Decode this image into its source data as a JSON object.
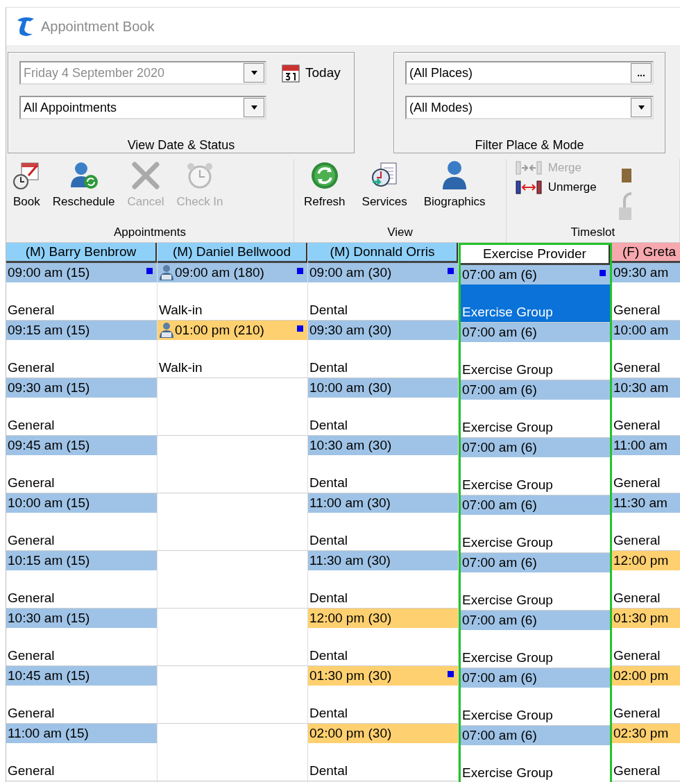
{
  "window": {
    "title": "Appointment Book"
  },
  "view_panel": {
    "caption": "View Date & Status",
    "date": {
      "value": "Friday 4 September 2020",
      "disabled": true
    },
    "status": {
      "value": "All Appointments"
    },
    "today": "Today"
  },
  "filter_panel": {
    "caption": "Filter Place & Mode",
    "place": {
      "value": "(All Places)",
      "button": "..."
    },
    "mode": {
      "value": "(All Modes)"
    }
  },
  "toolbar": [
    {
      "caption": "Appointments",
      "items": [
        {
          "label": "Book",
          "disabled": false
        },
        {
          "label": "Reschedule",
          "disabled": false
        },
        {
          "label": "Cancel",
          "disabled": true
        },
        {
          "label": "Check In",
          "disabled": true
        }
      ]
    },
    {
      "caption": "View",
      "items": [
        {
          "label": "Refresh",
          "disabled": false
        },
        {
          "label": "Services",
          "disabled": false
        },
        {
          "label": "Biographics",
          "disabled": false
        }
      ]
    },
    {
      "caption": "Timeslot",
      "items": [
        {
          "label": "Merge",
          "disabled": true
        },
        {
          "label": "Unmerge",
          "disabled": false
        }
      ]
    }
  ],
  "columns": [
    {
      "name": "(M) Barry Benbrow",
      "color": "#8fd0f8",
      "selected": false,
      "slots": [
        {
          "kind": "slot",
          "time": "09:00 am (15)",
          "label": "General",
          "arrived": false,
          "flag": true,
          "walk_in": false,
          "selected": false
        },
        {
          "kind": "slot",
          "time": "09:15 am (15)",
          "label": "General",
          "arrived": false,
          "flag": false,
          "walk_in": false,
          "selected": false
        },
        {
          "kind": "slot",
          "time": "09:30 am (15)",
          "label": "General",
          "arrived": false,
          "flag": false,
          "walk_in": false,
          "selected": false
        },
        {
          "kind": "slot",
          "time": "09:45 am (15)",
          "label": "General",
          "arrived": false,
          "flag": false,
          "walk_in": false,
          "selected": false
        },
        {
          "kind": "slot",
          "time": "10:00 am (15)",
          "label": "General",
          "arrived": false,
          "flag": false,
          "walk_in": false,
          "selected": false
        },
        {
          "kind": "slot",
          "time": "10:15 am (15)",
          "label": "General",
          "arrived": false,
          "flag": false,
          "walk_in": false,
          "selected": false
        },
        {
          "kind": "slot",
          "time": "10:30 am (15)",
          "label": "General",
          "arrived": false,
          "flag": false,
          "walk_in": false,
          "selected": false
        },
        {
          "kind": "slot",
          "time": "10:45 am (15)",
          "label": "General",
          "arrived": false,
          "flag": false,
          "walk_in": false,
          "selected": false
        },
        {
          "kind": "slot",
          "time": "11:00 am (15)",
          "label": "General",
          "arrived": false,
          "flag": false,
          "walk_in": false,
          "selected": false
        }
      ]
    },
    {
      "name": "(M) Daniel Bellwood",
      "color": "#8fd0f8",
      "selected": false,
      "slots": [
        {
          "kind": "slot",
          "time": "09:00 am (180)",
          "label": "Walk-in",
          "arrived": false,
          "flag": true,
          "walk_in": true,
          "selected": false
        },
        {
          "kind": "slot",
          "time": "01:00 pm (210)",
          "label": "Walk-in",
          "arrived": true,
          "flag": true,
          "walk_in": true,
          "selected": false
        },
        {
          "kind": "empty"
        },
        {
          "kind": "empty"
        },
        {
          "kind": "empty"
        },
        {
          "kind": "empty"
        },
        {
          "kind": "empty"
        },
        {
          "kind": "empty"
        },
        {
          "kind": "empty"
        }
      ]
    },
    {
      "name": "(M) Donnald Orris",
      "color": "#8fd0f8",
      "selected": false,
      "slots": [
        {
          "kind": "slot",
          "time": "09:00 am (30)",
          "label": "Dental",
          "arrived": false,
          "flag": true,
          "walk_in": false,
          "selected": false
        },
        {
          "kind": "slot",
          "time": "09:30 am (30)",
          "label": "Dental",
          "arrived": false,
          "flag": false,
          "walk_in": false,
          "selected": false
        },
        {
          "kind": "slot",
          "time": "10:00 am (30)",
          "label": "Dental",
          "arrived": false,
          "flag": false,
          "walk_in": false,
          "selected": false
        },
        {
          "kind": "slot",
          "time": "10:30 am (30)",
          "label": "Dental",
          "arrived": false,
          "flag": false,
          "walk_in": false,
          "selected": false
        },
        {
          "kind": "slot",
          "time": "11:00 am (30)",
          "label": "Dental",
          "arrived": false,
          "flag": false,
          "walk_in": false,
          "selected": false
        },
        {
          "kind": "slot",
          "time": "11:30 am (30)",
          "label": "Dental",
          "arrived": false,
          "flag": false,
          "walk_in": false,
          "selected": false
        },
        {
          "kind": "slot",
          "time": "12:00 pm (30)",
          "label": "Dental",
          "arrived": true,
          "flag": false,
          "walk_in": false,
          "selected": false
        },
        {
          "kind": "slot",
          "time": "01:30 pm (30)",
          "label": "Dental",
          "arrived": true,
          "flag": true,
          "walk_in": false,
          "selected": false
        },
        {
          "kind": "slot",
          "time": "02:00 pm (30)",
          "label": "Dental",
          "arrived": true,
          "flag": false,
          "walk_in": false,
          "selected": false
        }
      ]
    },
    {
      "name": "Exercise Provider",
      "color": "#ffffff",
      "selected": true,
      "slots": [
        {
          "kind": "slot",
          "time": "07:00 am (6)",
          "label": "Exercise Group",
          "arrived": false,
          "flag": true,
          "walk_in": false,
          "selected": true
        },
        {
          "kind": "slot",
          "time": "07:00 am (6)",
          "label": "Exercise Group",
          "arrived": false,
          "flag": false,
          "walk_in": false,
          "selected": false
        },
        {
          "kind": "slot",
          "time": "07:00 am (6)",
          "label": "Exercise Group",
          "arrived": false,
          "flag": false,
          "walk_in": false,
          "selected": false
        },
        {
          "kind": "slot",
          "time": "07:00 am (6)",
          "label": "Exercise Group",
          "arrived": false,
          "flag": false,
          "walk_in": false,
          "selected": false
        },
        {
          "kind": "slot",
          "time": "07:00 am (6)",
          "label": "Exercise Group",
          "arrived": false,
          "flag": false,
          "walk_in": false,
          "selected": false
        },
        {
          "kind": "slot",
          "time": "07:00 am (6)",
          "label": "Exercise Group",
          "arrived": false,
          "flag": false,
          "walk_in": false,
          "selected": false
        },
        {
          "kind": "slot",
          "time": "07:00 am (6)",
          "label": "Exercise Group",
          "arrived": false,
          "flag": false,
          "walk_in": false,
          "selected": false
        },
        {
          "kind": "slot",
          "time": "07:00 am (6)",
          "label": "Exercise Group",
          "arrived": false,
          "flag": false,
          "walk_in": false,
          "selected": false
        },
        {
          "kind": "slot",
          "time": "07:00 am (6)",
          "label": "Exercise Group",
          "arrived": false,
          "flag": false,
          "walk_in": false,
          "selected": false
        }
      ]
    },
    {
      "name": "(F) Greta",
      "color": "#f7a8ae",
      "selected": false,
      "slots": [
        {
          "kind": "slot",
          "time": "09:30 am",
          "label": "General",
          "arrived": false,
          "flag": false,
          "walk_in": false,
          "selected": false
        },
        {
          "kind": "slot",
          "time": "10:00 am",
          "label": "General",
          "arrived": false,
          "flag": false,
          "walk_in": false,
          "selected": false
        },
        {
          "kind": "slot",
          "time": "10:30 am",
          "label": "General",
          "arrived": false,
          "flag": false,
          "walk_in": false,
          "selected": false
        },
        {
          "kind": "slot",
          "time": "11:00 am",
          "label": "General",
          "arrived": false,
          "flag": false,
          "walk_in": false,
          "selected": false
        },
        {
          "kind": "slot",
          "time": "11:30 am",
          "label": "General",
          "arrived": false,
          "flag": false,
          "walk_in": false,
          "selected": false
        },
        {
          "kind": "slot",
          "time": "12:00 pm",
          "label": "General",
          "arrived": true,
          "flag": false,
          "walk_in": false,
          "selected": false
        },
        {
          "kind": "slot",
          "time": "01:30 pm",
          "label": "General",
          "arrived": true,
          "flag": false,
          "walk_in": false,
          "selected": false
        },
        {
          "kind": "slot",
          "time": "02:00 pm",
          "label": "General",
          "arrived": true,
          "flag": false,
          "walk_in": false,
          "selected": false
        },
        {
          "kind": "slot",
          "time": "02:30 pm",
          "label": "General",
          "arrived": true,
          "flag": false,
          "walk_in": false,
          "selected": false
        }
      ]
    }
  ]
}
